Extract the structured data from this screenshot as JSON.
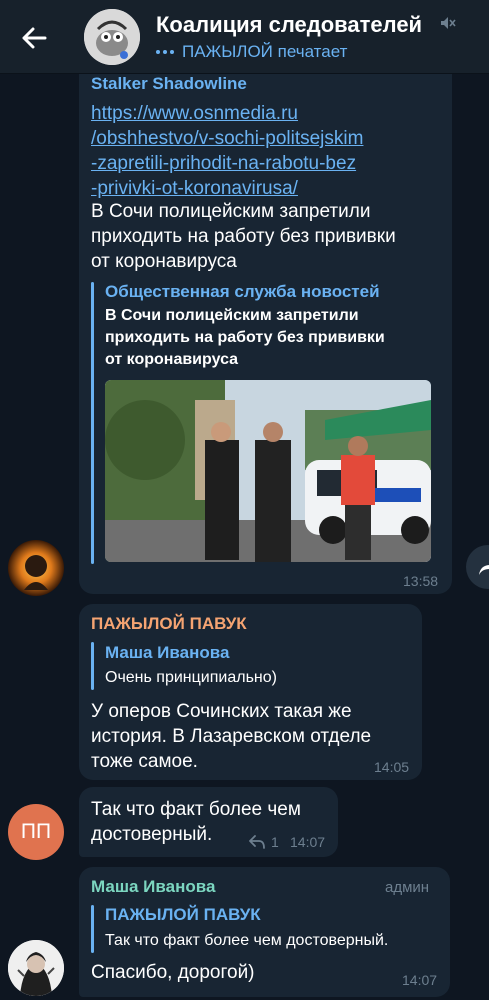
{
  "header": {
    "title": "Коалиция следователей",
    "status": "ПАЖЫЛОЙ печатает"
  },
  "messages": {
    "m1": {
      "sender": "Stalker Shadowline",
      "link_lines": [
        "https://www.osnmedia.ru",
        "/obshhestvo/v-sochi-politsejskim",
        "-zapretili-prihodit-na-rabotu-bez",
        "-privivki-ot-koronavirusa/"
      ],
      "text_lines": [
        "В Сочи полицейским запретили",
        "приходить на работу без прививки",
        "от коронавируса"
      ],
      "preview_site": "Общественная служба новостей",
      "preview_title_lines": [
        "В Сочи полицейским запретили",
        "приходить на работу без прививки",
        "от коронавируса"
      ],
      "time": "13:58"
    },
    "m2": {
      "sender": "ПАЖЫЛОЙ ПАВУК",
      "reply_name": "Маша Иванова",
      "reply_text": "Очень принципиально)",
      "text_lines": [
        "У оперов Сочинских такая же",
        "история. В Лазаревском отделе",
        "тоже самое."
      ],
      "time": "14:05"
    },
    "m3": {
      "avatar_initials": "ПП",
      "text_lines": [
        "Так что факт более чем",
        "достоверный."
      ],
      "reply_count": "1",
      "time": "14:07"
    },
    "m4": {
      "sender": "Маша Иванова",
      "role": "админ",
      "reply_name": "ПАЖЫЛОЙ ПАВУК",
      "reply_text": "Так что факт более чем достоверный.",
      "text": "Спасибо, дорогой)",
      "time": "14:07"
    }
  },
  "colors": {
    "background": "#0e1621",
    "bubble": "#182533",
    "accent": "#6ab2f2",
    "sender_pavuk": "#f5a472",
    "sender_masha": "#7cd6c0",
    "avatar_pp": "#e0734f"
  },
  "icons": {
    "back": "back-arrow-icon",
    "mute": "muted-speaker-icon",
    "share": "share-arrow-icon",
    "reply": "reply-arrow-icon"
  }
}
